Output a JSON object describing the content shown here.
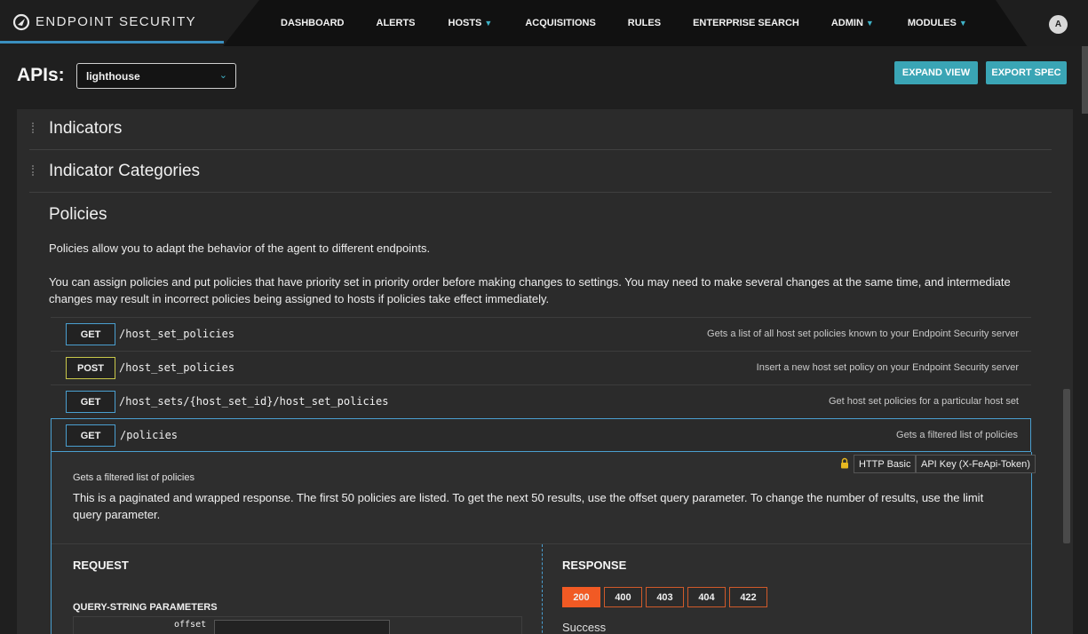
{
  "brand": {
    "name": "ENDPOINT SECURITY"
  },
  "nav": {
    "items": [
      {
        "label": "DASHBOARD",
        "dropdown": false
      },
      {
        "label": "ALERTS",
        "dropdown": false
      },
      {
        "label": "HOSTS",
        "dropdown": true
      },
      {
        "label": "ACQUISITIONS",
        "dropdown": false
      },
      {
        "label": "RULES",
        "dropdown": false
      },
      {
        "label": "ENTERPRISE SEARCH",
        "dropdown": false
      },
      {
        "label": "ADMIN",
        "dropdown": true
      },
      {
        "label": "MODULES",
        "dropdown": true
      }
    ],
    "avatar": "A"
  },
  "apis": {
    "label": "APIs:",
    "selected": "lighthouse",
    "expand_view": "EXPAND VIEW",
    "export_spec": "EXPORT SPEC"
  },
  "sections": {
    "indicators": "Indicators",
    "indicator_categories": "Indicator Categories",
    "policies": {
      "title": "Policies",
      "desc1": "Policies allow you to adapt the behavior of the agent to different endpoints.",
      "desc2": "You can assign policies and put policies that have priority set in priority order before making changes to settings. You may need to make several changes at the same time, and intermediate changes may result in incorrect policies being assigned to hosts if policies take effect immediately."
    }
  },
  "endpoints": [
    {
      "method": "GET",
      "path": "/host_set_policies",
      "summary": "Gets a list of all host set policies known to your Endpoint Security server"
    },
    {
      "method": "POST",
      "path": "/host_set_policies",
      "summary": "Insert a new host set policy on your Endpoint Security server"
    },
    {
      "method": "GET",
      "path": "/host_sets/{host_set_id}/host_set_policies",
      "summary": "Get host set policies for a particular host set"
    },
    {
      "method": "GET",
      "path": "/policies",
      "summary": "Gets a filtered list of policies"
    }
  ],
  "expanded": {
    "small": "Gets a filtered list of policies",
    "text": "This is a paginated and wrapped response. The first 50 policies are listed. To get the next 50 results, use the offset query parameter. To change the number of results, use the limit query parameter.",
    "auth": [
      "HTTP Basic",
      "API Key (X-FeApi-Token)"
    ],
    "request_title": "REQUEST",
    "response_title": "RESPONSE",
    "qsp_title": "QUERY-STRING PARAMETERS",
    "param_name": "offset",
    "codes": [
      "200",
      "400",
      "403",
      "404",
      "422"
    ],
    "success": "Success"
  },
  "colors": {
    "accent": "#3aa5b5",
    "method_border": "#4a9fd0",
    "post_border": "#c9c84a",
    "code_active": "#f15a24"
  }
}
